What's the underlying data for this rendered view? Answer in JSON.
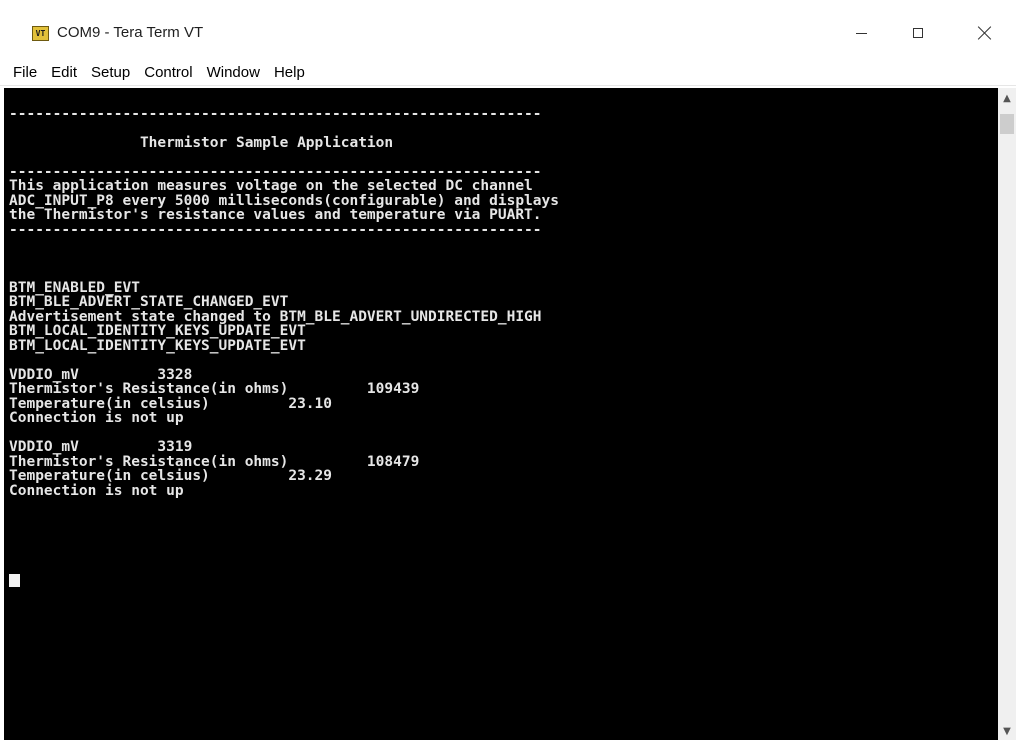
{
  "window": {
    "title": "COM9 - Tera Term VT",
    "app_icon_text": "VT",
    "controls": {
      "minimize": "minimize",
      "maximize": "maximize",
      "close": "close"
    }
  },
  "menu": [
    "File",
    "Edit",
    "Setup",
    "Control",
    "Window",
    "Help"
  ],
  "terminal": {
    "lines": [
      "",
      "-------------------------------------------------------------",
      "",
      "               Thermistor Sample Application",
      "",
      "-------------------------------------------------------------",
      "This application measures voltage on the selected DC channel",
      "ADC_INPUT_P8 every 5000 milliseconds(configurable) and displays",
      "the Thermistor's resistance values and temperature via PUART.",
      "-------------------------------------------------------------",
      "",
      "",
      "",
      "BTM_ENABLED_EVT",
      "BTM_BLE_ADVERT_STATE_CHANGED_EVT",
      "Advertisement state changed to BTM_BLE_ADVERT_UNDIRECTED_HIGH",
      "BTM_LOCAL_IDENTITY_KEYS_UPDATE_EVT",
      "BTM_LOCAL_IDENTITY_KEYS_UPDATE_EVT",
      "",
      "VDDIO_mV         3328",
      "Thermistor's Resistance(in ohms)         109439",
      "Temperature(in celsius)         23.10",
      "Connection is not up",
      "",
      "VDDIO_mV         3319",
      "Thermistor's Resistance(in ohms)         108479",
      "Temperature(in celsius)         23.29",
      "Connection is not up"
    ]
  },
  "scrollbar": {
    "up_icon": "scroll-up-arrow",
    "down_icon": "scroll-down-arrow"
  },
  "colors": {
    "terminal_bg": "#000000",
    "terminal_fg": "#e6e6e6"
  }
}
